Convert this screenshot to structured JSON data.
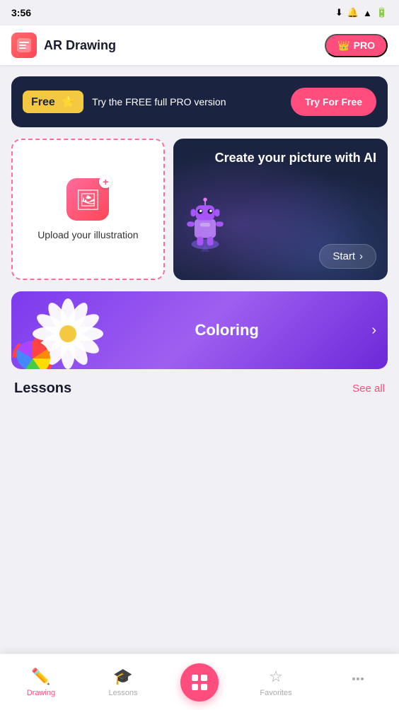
{
  "statusBar": {
    "time": "3:56",
    "icons": [
      "download-icon",
      "notification-icon",
      "wifi-icon",
      "battery-icon"
    ]
  },
  "topBar": {
    "appName": "AR Drawing",
    "proBadge": "PRO"
  },
  "freeBanner": {
    "freeLabel": "Free",
    "description": "Try the FREE full PRO version",
    "buttonLabel": "Try For Free"
  },
  "uploadCard": {
    "label": "Upload your illustration"
  },
  "aiCard": {
    "title": "Create your picture with AI",
    "startLabel": "Start"
  },
  "coloringBanner": {
    "label": "Coloring"
  },
  "lessonsSection": {
    "title": "Lessons",
    "seeAllLabel": "See all"
  },
  "bottomNav": {
    "items": [
      {
        "label": "Drawing",
        "active": true
      },
      {
        "label": "Lessons",
        "active": false
      },
      {
        "label": "",
        "center": true
      },
      {
        "label": "Favorites",
        "active": false
      },
      {
        "label": "",
        "active": false
      }
    ]
  }
}
